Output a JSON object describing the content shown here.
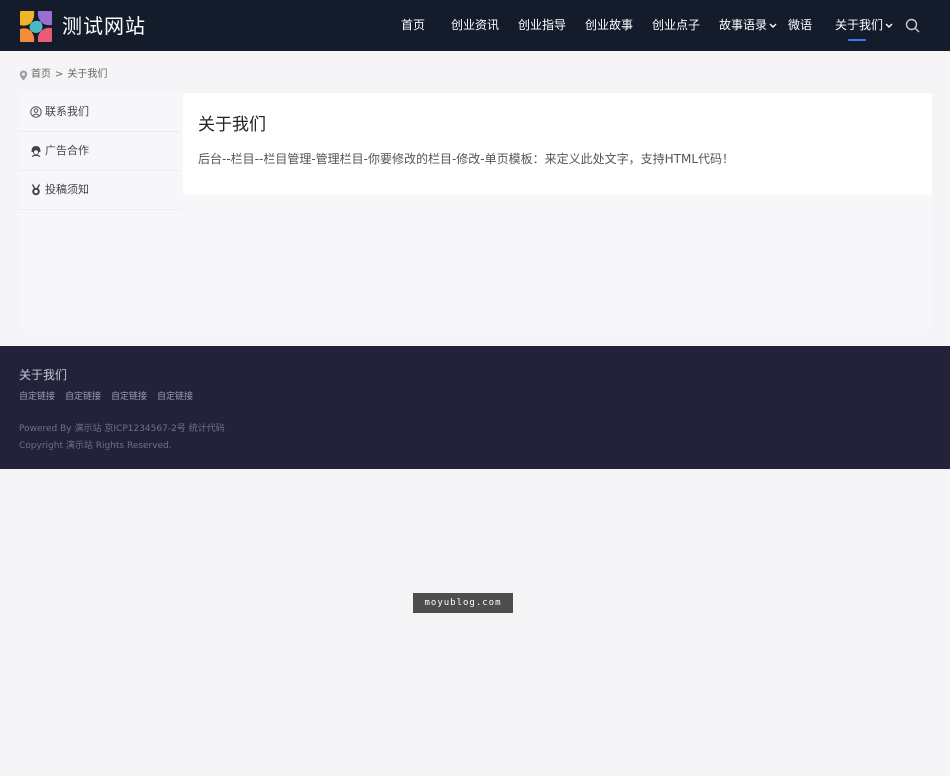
{
  "header": {
    "site_name": "测试网站",
    "nav": [
      {
        "label": "首页"
      },
      {
        "label": "创业资讯"
      },
      {
        "label": "创业指导"
      },
      {
        "label": "创业故事"
      },
      {
        "label": "创业点子"
      },
      {
        "label": "故事语录",
        "has_dropdown": true
      },
      {
        "label": "微语"
      },
      {
        "label": "关于我们",
        "has_dropdown": true,
        "active": true
      }
    ],
    "accent_color": "#3d7bf5"
  },
  "breadcrumb": {
    "home": "首页",
    "separator": ">",
    "current": "关于我们"
  },
  "sidebar": {
    "items": [
      {
        "label": "联系我们",
        "icon": "user-circle-icon"
      },
      {
        "label": "广告合作",
        "icon": "user-avatar-icon"
      },
      {
        "label": "投稿须知",
        "icon": "medal-icon"
      }
    ]
  },
  "main": {
    "title": "关于我们",
    "text": "后台--栏目--栏目管理-管理栏目-你要修改的栏目-修改-单页模板：来定义此处文字，支持HTML代码！"
  },
  "footer": {
    "title": "关于我们",
    "links": [
      "自定链接",
      "自定链接",
      "自定链接",
      "自定链接"
    ],
    "powered_by": "Powered By 演示站",
    "icp": "京ICP1234567-2号",
    "stats": "统计代码",
    "copyright": "Copyright 演示站 Rights Reserved."
  },
  "watermark": "moyublog.com"
}
